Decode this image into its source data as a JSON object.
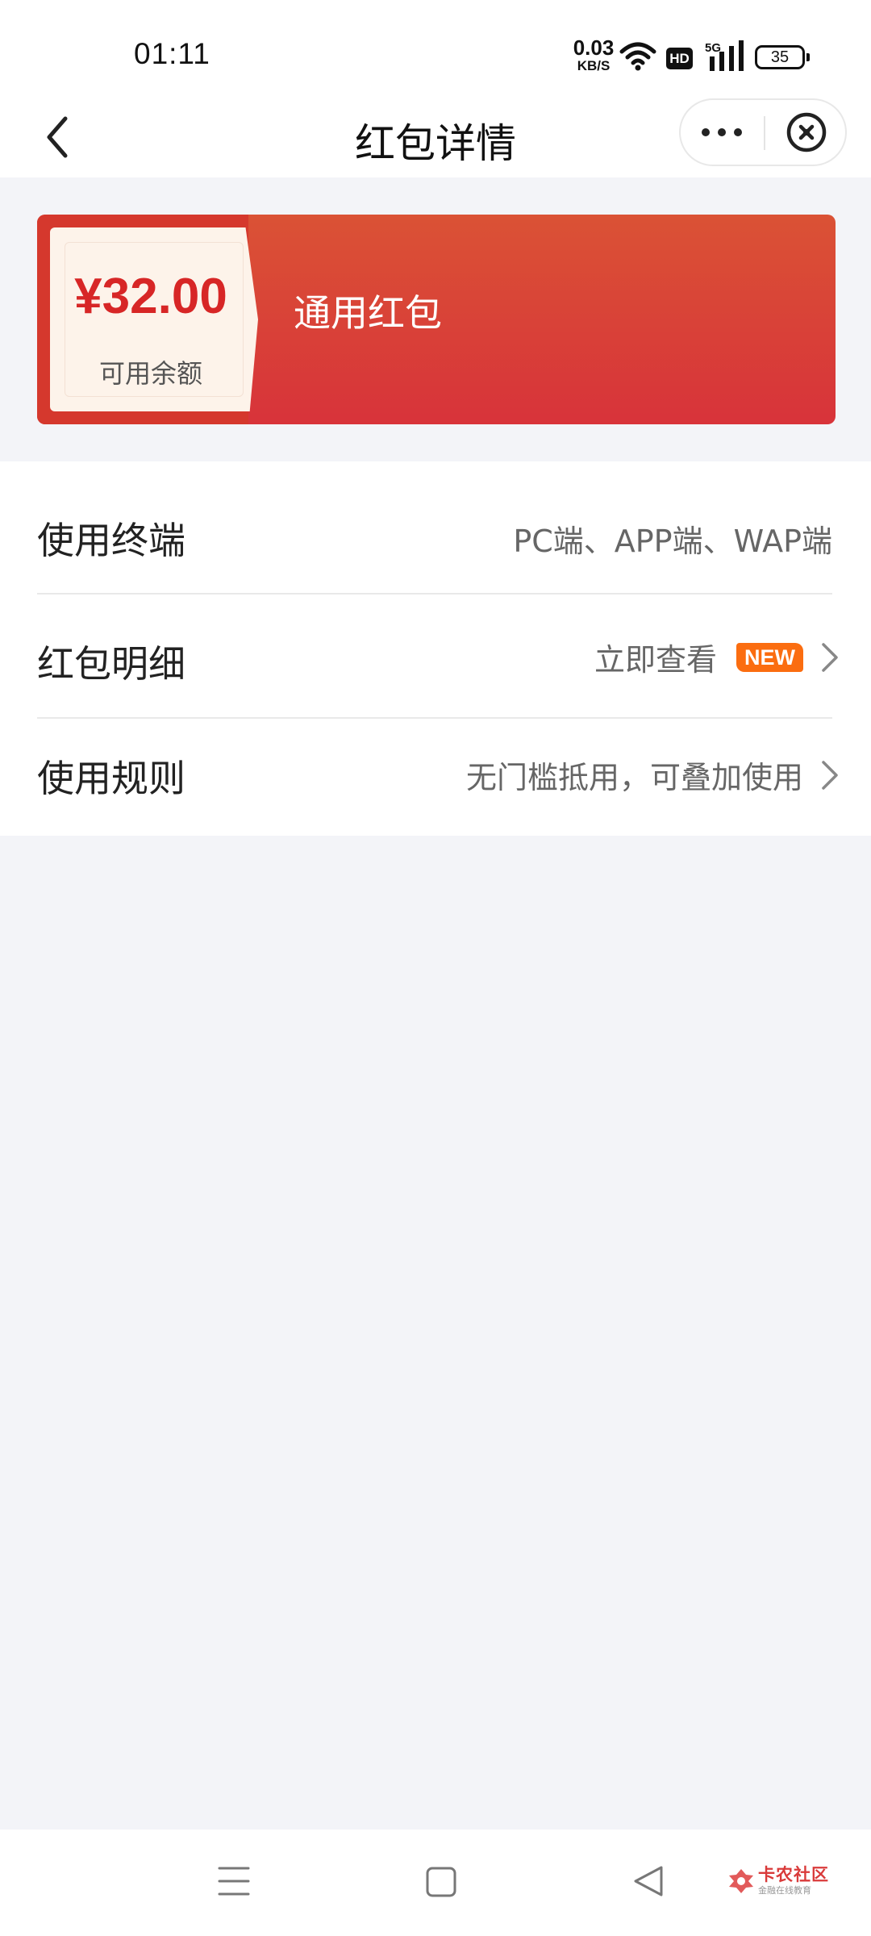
{
  "status_bar": {
    "time": "01:11",
    "speed_value": "0.03",
    "speed_unit": "KB/S",
    "hd": "HD",
    "network": "5G",
    "battery": "35"
  },
  "nav": {
    "title": "红包详情"
  },
  "card": {
    "amount": "¥32.00",
    "amount_label": "可用余额",
    "type": "通用红包",
    "colors": {
      "card_red": "#d8333a",
      "amount_red": "#d72626",
      "coupon_bg": "#fdf3ea"
    }
  },
  "list": {
    "rows": [
      {
        "label": "使用终端",
        "value": "PC端、APP端、WAP端"
      },
      {
        "label": "红包明细",
        "value": "立即查看",
        "badge": "NEW"
      },
      {
        "label": "使用规则",
        "value": "无门槛抵用，可叠加使用"
      }
    ],
    "badge_color": "#fb6d10"
  },
  "watermark": {
    "title": "卡农社区",
    "subtitle": "金融在线教育"
  }
}
